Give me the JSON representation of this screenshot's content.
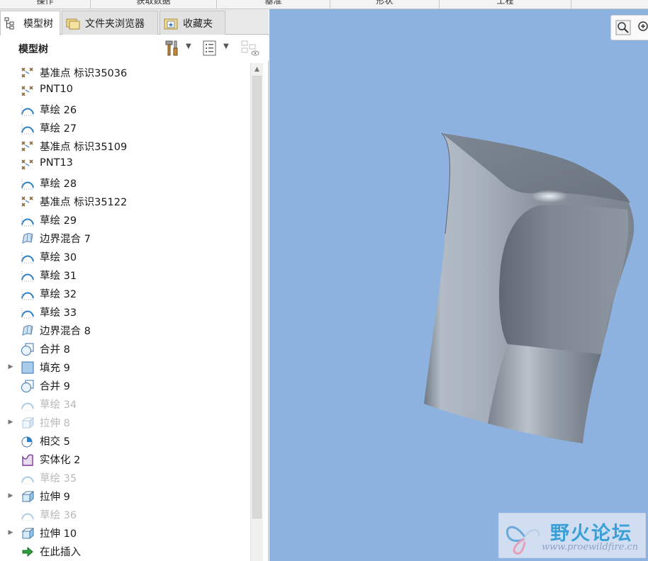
{
  "ribbon": {
    "tabs": [
      "操作",
      "获取数据",
      "基准",
      "形状",
      "工程"
    ]
  },
  "panel_tabs": [
    {
      "label": "模型树",
      "icon": "model-tree-icon",
      "active": true
    },
    {
      "label": "文件夹浏览器",
      "icon": "folder-browser-icon",
      "active": false
    },
    {
      "label": "收藏夹",
      "icon": "favorites-icon",
      "active": false
    }
  ],
  "tree_header": {
    "title": "模型树",
    "settings_icon": "tools-icon",
    "show_icon": "list-settings-icon",
    "filter_icon": "tree-filter-icon"
  },
  "tree_items": [
    {
      "label": "基准点 标识35036",
      "icon": "datum-point-icon",
      "expandable": false,
      "suppressed": false
    },
    {
      "label": "PNT10",
      "icon": "datum-point-icon",
      "expandable": false,
      "suppressed": false
    },
    {
      "label": "草绘 26",
      "icon": "sketch-icon",
      "expandable": false,
      "suppressed": false
    },
    {
      "label": "草绘 27",
      "icon": "sketch-icon",
      "expandable": false,
      "suppressed": false
    },
    {
      "label": "基准点 标识35109",
      "icon": "datum-point-icon",
      "expandable": false,
      "suppressed": false
    },
    {
      "label": "PNT13",
      "icon": "datum-point-icon",
      "expandable": false,
      "suppressed": false
    },
    {
      "label": "草绘 28",
      "icon": "sketch-icon",
      "expandable": false,
      "suppressed": false
    },
    {
      "label": "基准点 标识35122",
      "icon": "datum-point-icon",
      "expandable": false,
      "suppressed": false
    },
    {
      "label": "草绘 29",
      "icon": "sketch-icon",
      "expandable": false,
      "suppressed": false
    },
    {
      "label": "边界混合 7",
      "icon": "boundary-blend-icon",
      "expandable": false,
      "suppressed": false
    },
    {
      "label": "草绘 30",
      "icon": "sketch-icon",
      "expandable": false,
      "suppressed": false
    },
    {
      "label": "草绘 31",
      "icon": "sketch-icon",
      "expandable": false,
      "suppressed": false
    },
    {
      "label": "草绘 32",
      "icon": "sketch-icon",
      "expandable": false,
      "suppressed": false
    },
    {
      "label": "草绘 33",
      "icon": "sketch-icon",
      "expandable": false,
      "suppressed": false
    },
    {
      "label": "边界混合 8",
      "icon": "boundary-blend-icon",
      "expandable": false,
      "suppressed": false
    },
    {
      "label": "合并 8",
      "icon": "merge-icon",
      "expandable": false,
      "suppressed": false
    },
    {
      "label": "填充 9",
      "icon": "fill-icon",
      "expandable": true,
      "suppressed": false
    },
    {
      "label": "合并 9",
      "icon": "merge-icon",
      "expandable": false,
      "suppressed": false
    },
    {
      "label": "草绘 34",
      "icon": "sketch-icon",
      "expandable": false,
      "suppressed": true
    },
    {
      "label": "拉伸 8",
      "icon": "extrude-icon",
      "expandable": true,
      "suppressed": true
    },
    {
      "label": "相交 5",
      "icon": "intersect-icon",
      "expandable": false,
      "suppressed": false
    },
    {
      "label": "实体化 2",
      "icon": "solidify-icon",
      "expandable": false,
      "suppressed": false
    },
    {
      "label": "草绘 35",
      "icon": "sketch-icon",
      "expandable": false,
      "suppressed": true
    },
    {
      "label": "拉伸 9",
      "icon": "extrude-icon",
      "expandable": true,
      "suppressed": false
    },
    {
      "label": "草绘 36",
      "icon": "sketch-icon",
      "expandable": false,
      "suppressed": true
    },
    {
      "label": "拉伸 10",
      "icon": "extrude-icon",
      "expandable": true,
      "suppressed": false
    },
    {
      "label": "在此插入",
      "icon": "insert-here-arrow-icon",
      "expandable": false,
      "suppressed": false
    }
  ],
  "viewport": {
    "background": "#8db2e0",
    "model_color": "#8e98a3",
    "toolbar_icons": [
      "zoom-icon",
      "zoom-in-icon"
    ]
  },
  "watermark": {
    "title": "野火论坛",
    "url": "www.proewildfire.cn",
    "logo": "butterfly-logo-icon"
  }
}
